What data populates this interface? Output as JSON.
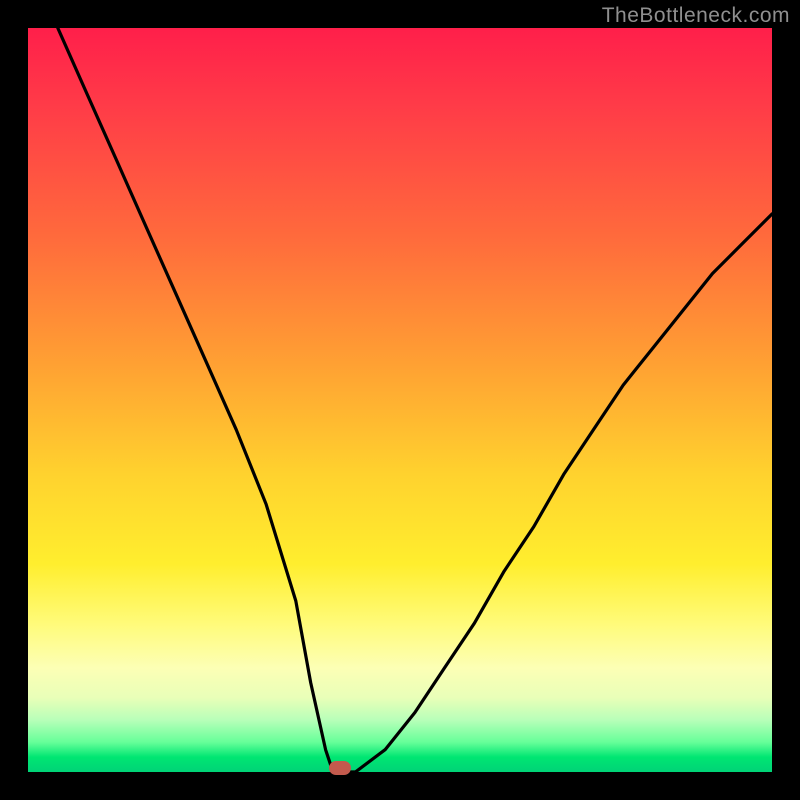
{
  "watermark": "TheBottleneck.com",
  "colors": {
    "frame": "#000000",
    "gradient_top": "#ff1f4a",
    "gradient_mid": "#ffd22e",
    "gradient_bottom": "#00d377",
    "curve": "#000000",
    "marker": "#c35a4d"
  },
  "chart_data": {
    "type": "line",
    "title": "",
    "xlabel": "",
    "ylabel": "",
    "xlim": [
      0,
      100
    ],
    "ylim": [
      0,
      100
    ],
    "x": [
      4,
      8,
      12,
      16,
      20,
      24,
      28,
      32,
      36,
      38,
      40,
      41,
      42,
      44,
      48,
      52,
      56,
      60,
      64,
      68,
      72,
      76,
      80,
      84,
      88,
      92,
      96,
      100
    ],
    "values": [
      100,
      91,
      82,
      73,
      64,
      55,
      46,
      36,
      23,
      12,
      3,
      0,
      0,
      0,
      3,
      8,
      14,
      20,
      27,
      33,
      40,
      46,
      52,
      57,
      62,
      67,
      71,
      75
    ],
    "marker": {
      "x": 42,
      "y": 0
    },
    "notes": "x and y are percentages of the plot area (0=left/bottom, 100=right/top). Curve is a V-shaped bottleneck profile reaching its minimum near x≈42."
  }
}
